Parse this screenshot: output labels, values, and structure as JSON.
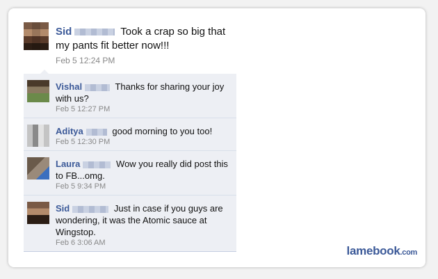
{
  "post": {
    "author": "Sid",
    "text": "Took a crap so big that my pants fit better now!!!",
    "timestamp": "Feb 5 12:24 PM"
  },
  "comments": [
    {
      "author": "Vishal",
      "text": "Thanks for sharing your joy with us?",
      "timestamp": "Feb 5 12:27 PM"
    },
    {
      "author": "Aditya",
      "text": "good morning to you too!",
      "timestamp": "Feb 5 12:30 PM"
    },
    {
      "author": "Laura",
      "text": "Wow you really did post this to FB...omg.",
      "timestamp": "Feb 5 9:34 PM"
    },
    {
      "author": "Sid",
      "text": "Just in case if you guys are wondering, it was the Atomic sauce at Wingstop.",
      "timestamp": "Feb 6 3:06 AM"
    }
  ],
  "branding": {
    "logo": "lamebook",
    "domain": ".com"
  },
  "colors": {
    "link": "#3b5998",
    "comment_bg": "#edeff4",
    "timestamp": "#888888"
  }
}
